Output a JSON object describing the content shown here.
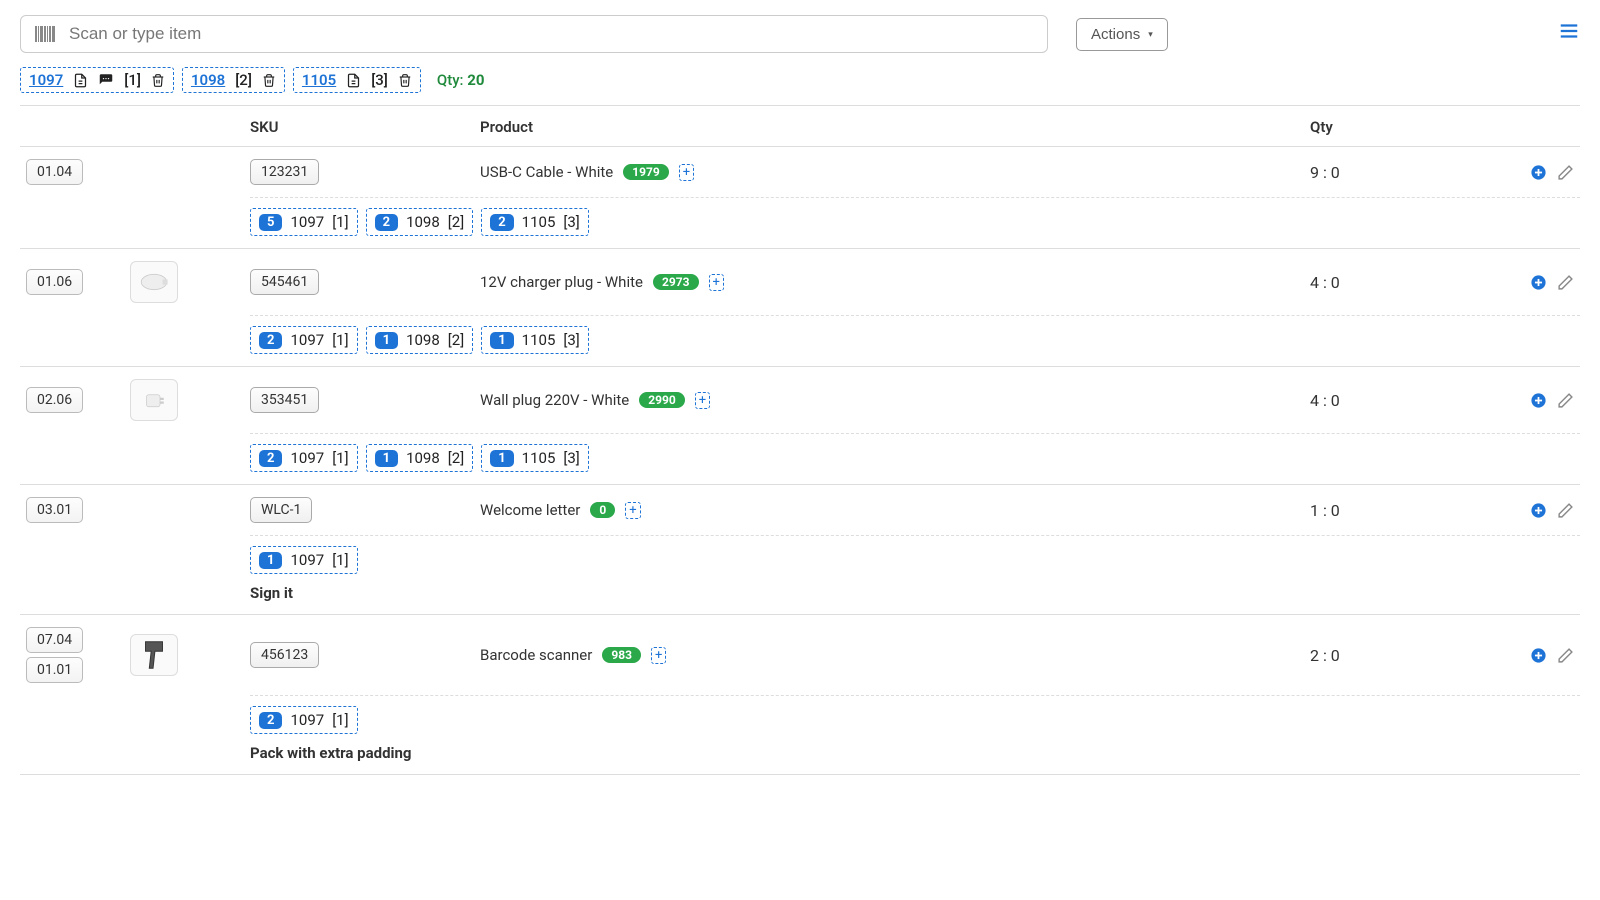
{
  "search": {
    "placeholder": "Scan or type item"
  },
  "actions_label": "Actions",
  "orders": [
    {
      "id": "1097",
      "has_doc": true,
      "has_chat": true,
      "bracket": "[1]"
    },
    {
      "id": "1098",
      "has_doc": false,
      "has_chat": false,
      "bracket": "[2]"
    },
    {
      "id": "1105",
      "has_doc": true,
      "has_chat": false,
      "bracket": "[3]"
    }
  ],
  "qty_label": "Qty:",
  "qty_total": "20",
  "headers": {
    "sku": "SKU",
    "product": "Product",
    "qty": "Qty"
  },
  "rows": [
    {
      "locations": [
        "01.04"
      ],
      "thumb": null,
      "sku": "123231",
      "product": "USB-C Cable - White",
      "stock": "1979",
      "qty": "9 : 0",
      "allocs": [
        {
          "n": "5",
          "order": "1097",
          "bracket": "[1]"
        },
        {
          "n": "2",
          "order": "1098",
          "bracket": "[2]"
        },
        {
          "n": "2",
          "order": "1105",
          "bracket": "[3]"
        }
      ],
      "note": null
    },
    {
      "locations": [
        "01.06"
      ],
      "thumb": "charger",
      "sku": "545461",
      "product": "12V charger plug - White",
      "stock": "2973",
      "qty": "4 : 0",
      "allocs": [
        {
          "n": "2",
          "order": "1097",
          "bracket": "[1]"
        },
        {
          "n": "1",
          "order": "1098",
          "bracket": "[2]"
        },
        {
          "n": "1",
          "order": "1105",
          "bracket": "[3]"
        }
      ],
      "note": null
    },
    {
      "locations": [
        "02.06"
      ],
      "thumb": "wallplug",
      "sku": "353451",
      "product": "Wall plug 220V - White",
      "stock": "2990",
      "qty": "4 : 0",
      "allocs": [
        {
          "n": "2",
          "order": "1097",
          "bracket": "[1]"
        },
        {
          "n": "1",
          "order": "1098",
          "bracket": "[2]"
        },
        {
          "n": "1",
          "order": "1105",
          "bracket": "[3]"
        }
      ],
      "note": null
    },
    {
      "locations": [
        "03.01"
      ],
      "thumb": null,
      "sku": "WLC-1",
      "product": "Welcome letter",
      "stock": "0",
      "qty": "1 : 0",
      "allocs": [
        {
          "n": "1",
          "order": "1097",
          "bracket": "[1]"
        }
      ],
      "note": "Sign it"
    },
    {
      "locations": [
        "07.04",
        "01.01"
      ],
      "thumb": "scanner",
      "sku": "456123",
      "product": "Barcode scanner",
      "stock": "983",
      "qty": "2 : 0",
      "allocs": [
        {
          "n": "2",
          "order": "1097",
          "bracket": "[1]"
        }
      ],
      "note": "Pack with extra padding"
    }
  ]
}
